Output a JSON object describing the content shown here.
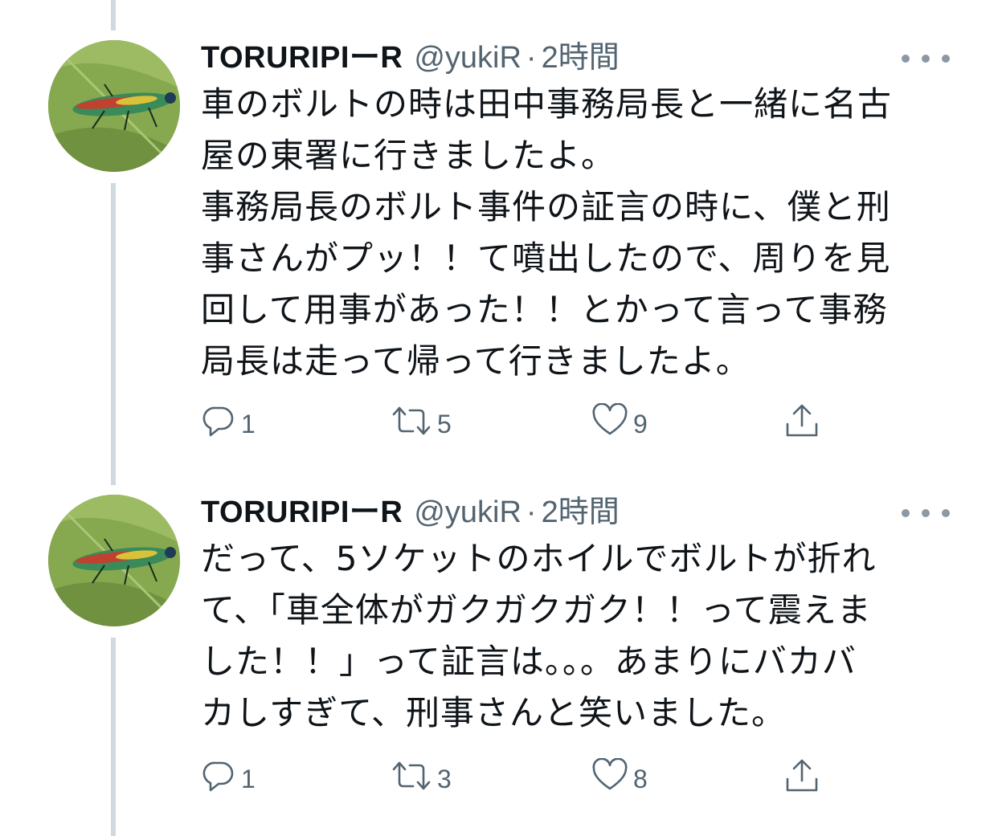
{
  "tweets": [
    {
      "author_name": "TORURIPIーR",
      "handle": "@yukiR",
      "separator": "·",
      "time": "2時間",
      "text": "車のボルトの時は田中事務局長と一緒に名古\n屋の東署に行きましたよ。\n事務局長のボルト事件の証言の時に、僕と刑\n事さんがプッ！！て噴出したので、周りを見\n回して用事があった！！とかって言って事務\n局長は走って帰って行きましたよ。",
      "reply_count": "1",
      "retweet_count": "5",
      "like_count": "9"
    },
    {
      "author_name": "TORURIPIーR",
      "handle": "@yukiR",
      "separator": "·",
      "time": "2時間",
      "text": "だって、5ソケットのホイルでボルトが折れ\nて、「車全体がガクガクガク！！って震えま\nした！！」って証言は。。。あまりにバカバ\nカしすぎて、刑事さんと笑いました。",
      "reply_count": "1",
      "retweet_count": "3",
      "like_count": "8"
    }
  ],
  "icons": {
    "reply": "reply-icon",
    "retweet": "retweet-icon",
    "like": "heart-icon",
    "share": "share-icon",
    "more": "more-icon"
  },
  "colors": {
    "text": "#0f1419",
    "secondary": "#536471",
    "thread_line": "#cfd9de"
  }
}
